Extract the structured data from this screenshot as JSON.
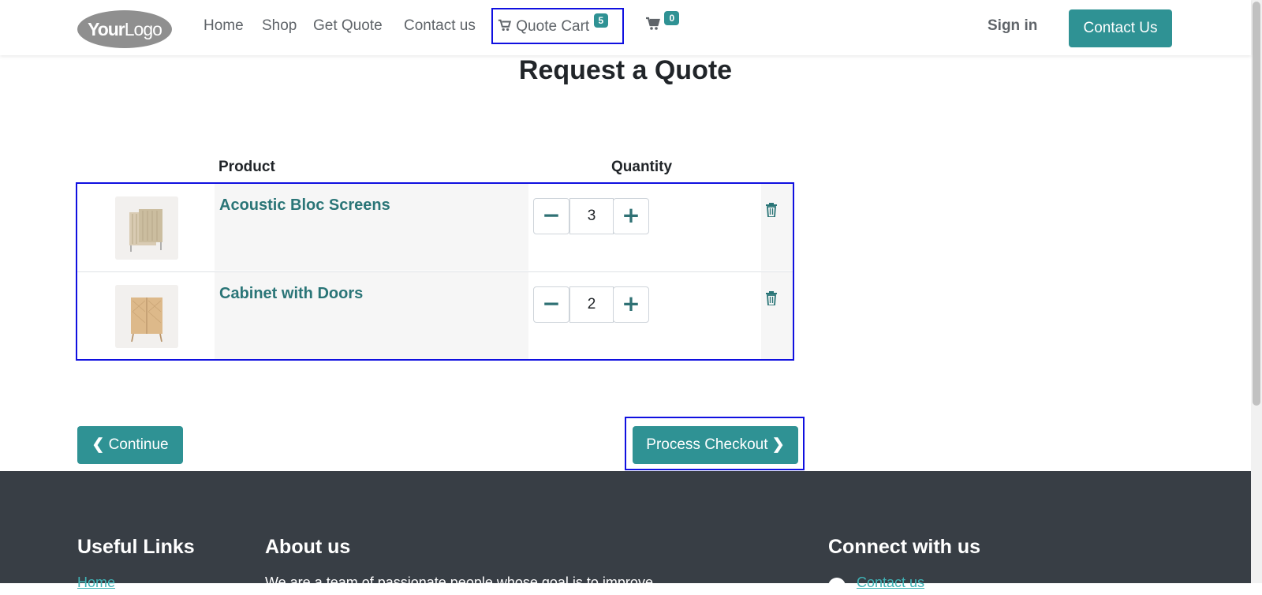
{
  "header": {
    "logo_part1": "Your",
    "logo_part2": "Logo",
    "nav": [
      {
        "label": "Home"
      },
      {
        "label": "Shop"
      },
      {
        "label": "Get Quote"
      },
      {
        "label": "Contact us"
      }
    ],
    "quote_cart": {
      "label": "Quote Cart",
      "count": "5"
    },
    "cart_count": "0",
    "sign_in": "Sign in",
    "contact_button": "Contact Us"
  },
  "main": {
    "title": "Request a Quote",
    "columns": {
      "product": "Product",
      "quantity": "Quantity"
    },
    "items": [
      {
        "name": "Acoustic Bloc Screens",
        "quantity": "3"
      },
      {
        "name": "Cabinet with Doors",
        "quantity": "2"
      }
    ],
    "continue_button": "Continue",
    "checkout_button": "Process Checkout"
  },
  "footer": {
    "useful_links": {
      "title": "Useful Links",
      "first_link": "Home"
    },
    "about": {
      "title": "About us",
      "text": "We are a team of passionate people whose goal is to improve"
    },
    "connect": {
      "title": "Connect with us",
      "first_link": "Contact us"
    }
  },
  "colors": {
    "accent": "#2f9294",
    "product_link": "#2a7577",
    "highlight_border": "#1010e0",
    "footer_bg": "#383e45"
  },
  "icons": [
    "cart-icon",
    "plus-icon",
    "minus-icon",
    "trash-icon",
    "chevron-left-icon",
    "chevron-right-icon"
  ]
}
